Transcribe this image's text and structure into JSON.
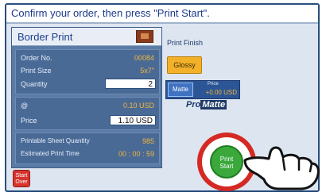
{
  "instruction": "Confirm your order, then press \"Print Start\".",
  "panel_title": "Border Print",
  "order": {
    "order_no_label": "Order No.",
    "order_no_value": "00084",
    "print_size_label": "Print Size",
    "print_size_value": "5x7\"",
    "quantity_label": "Quantity",
    "quantity_value": "2"
  },
  "pricing": {
    "unit_label": "@",
    "unit_value": "0.10 USD",
    "price_label": "Price",
    "price_value": "1.10 USD"
  },
  "summary": {
    "sheet_qty_label": "Printable Sheet Quantity",
    "sheet_qty_value": "985",
    "time_label": "Estimated Print Time",
    "time_value": "00 : 00 : 59"
  },
  "print_finish": {
    "label": "Print Finish",
    "glossy_label": "Glossy",
    "matte_label": "Matte",
    "matte_price_label": "Price",
    "matte_price_value": "+0.00 USD",
    "promatte_prefix": "Pro",
    "promatte_suffix": "Matte"
  },
  "buttons": {
    "start_over_line1": "Start",
    "start_over_line2": "Over",
    "print_start_line1": "Print",
    "print_start_line2": "Start"
  },
  "colors": {
    "accent_blue": "#2c5595",
    "glossy": "#f3b12a",
    "print_start": "#3aa83b",
    "start_over": "#d7342d",
    "highlight_ring": "#d42a23"
  }
}
